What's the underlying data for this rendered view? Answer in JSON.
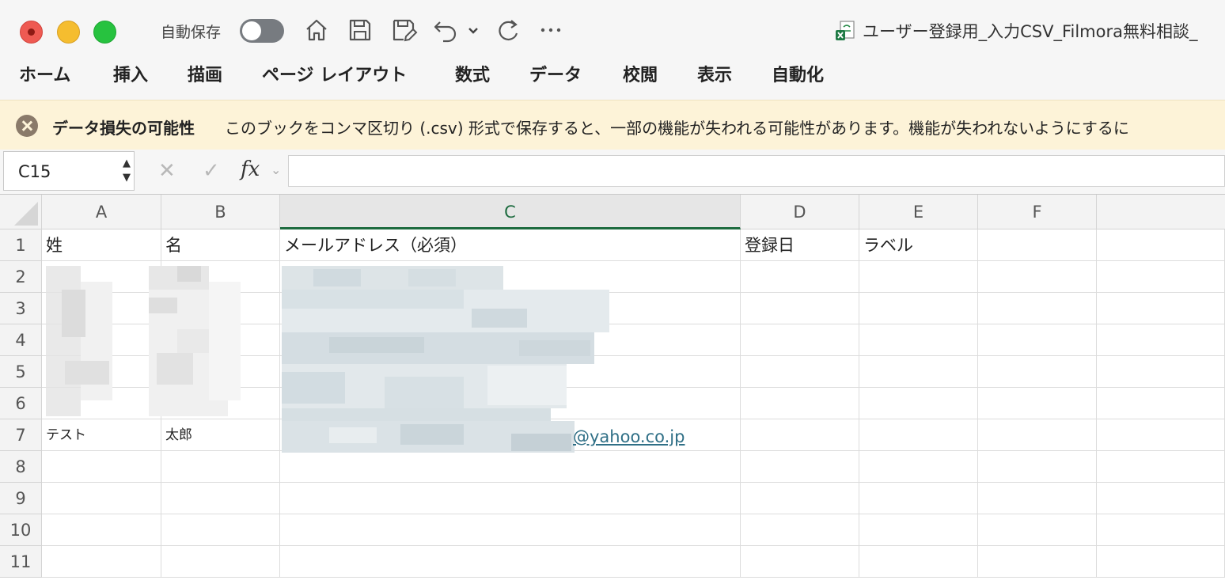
{
  "titlebar": {
    "autosave_label": "自動保存",
    "document_title": "ユーザー登録用_入力CSV_Filmora無料相談_"
  },
  "ribbon": {
    "tabs": [
      "ホーム",
      "挿入",
      "描画",
      "ページ レイアウト",
      "数式",
      "データ",
      "校閲",
      "表示",
      "自動化"
    ]
  },
  "warning": {
    "title": "データ損失の可能性",
    "message": "このブックをコンマ区切り (.csv) 形式で保存すると、一部の機能が失われる可能性があります。機能が失われないようにするに"
  },
  "formula_bar": {
    "name_box": "C15",
    "fx_label": "fx",
    "formula": ""
  },
  "sheet": {
    "columns": [
      "A",
      "B",
      "C",
      "D",
      "E",
      "F"
    ],
    "rows": [
      "1",
      "2",
      "3",
      "4",
      "5",
      "6",
      "7",
      "8",
      "9",
      "10",
      "11"
    ],
    "selected_column": "C",
    "header_row": {
      "a": "姓",
      "b": "名",
      "c": "メールアドレス（必須）",
      "d": "登録日",
      "e": "ラベル"
    },
    "row7": {
      "a": "テスト",
      "b": "太郎",
      "c_visible": "@yahoo.co.jp"
    }
  }
}
